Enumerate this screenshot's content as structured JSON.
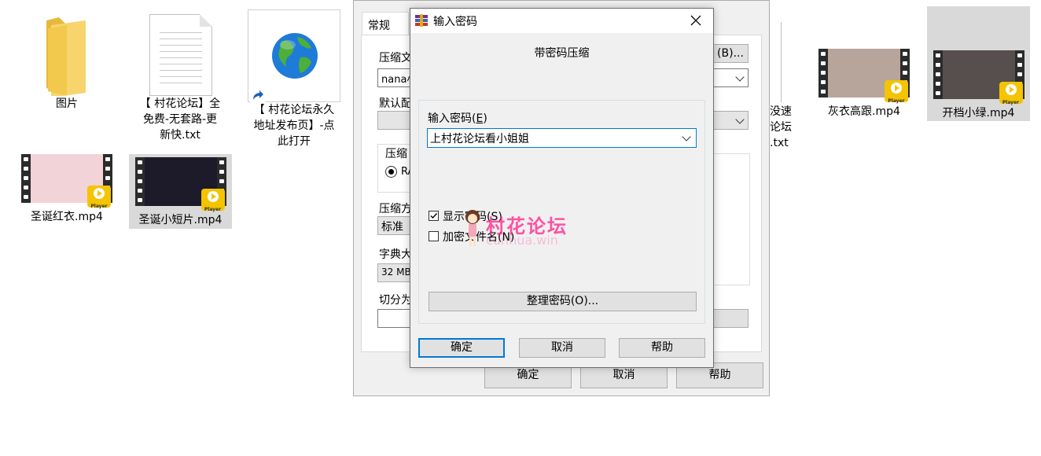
{
  "desktop": {
    "files": [
      {
        "label": "图片"
      },
      {
        "label": "【 村花论坛】全\n免费-无套路-更\n新快.txt"
      },
      {
        "label": "【 村花论坛永久\n地址发布页】-点\n此打开"
      },
      {
        "label": "灰衣高跟.mp4"
      },
      {
        "label": "开档小绿.mp4"
      },
      {
        "label": "圣诞红衣.mp4"
      },
      {
        "label": "圣诞小短片.mp4"
      }
    ],
    "partial_right_label": "没速\n论坛\n.txt",
    "player_badge": "Player"
  },
  "back_window": {
    "tab_general": "常规",
    "browse_suffix": "(B)...",
    "row_labels": [
      "压缩文",
      "默认配",
      "压缩",
      "压缩方",
      "字典大",
      "切分为"
    ],
    "archive_name_value": "nana小",
    "rar_radio": "RA",
    "compression_method_value": "标准",
    "dictionary_value": "32 MB",
    "ok": "确定",
    "cancel": "取消",
    "help": "帮助"
  },
  "dialog": {
    "title": "输入密码",
    "subtitle": "带密码压缩",
    "password_label": "输入密码(",
    "password_label_key": "E",
    "password_label_end": ")",
    "password_value": "上村花论坛看小姐姐",
    "show_password": "显示密码(S)",
    "encrypt_names": "加密文件名(N)",
    "show_password_checked": true,
    "encrypt_names_checked": false,
    "organize_button": "整理密码(O)...",
    "ok": "确定",
    "cancel": "取消",
    "help": "帮助"
  },
  "watermark": {
    "text": "村花论坛",
    "sub": "cunhua.win",
    "color": "#ff2d8e"
  }
}
